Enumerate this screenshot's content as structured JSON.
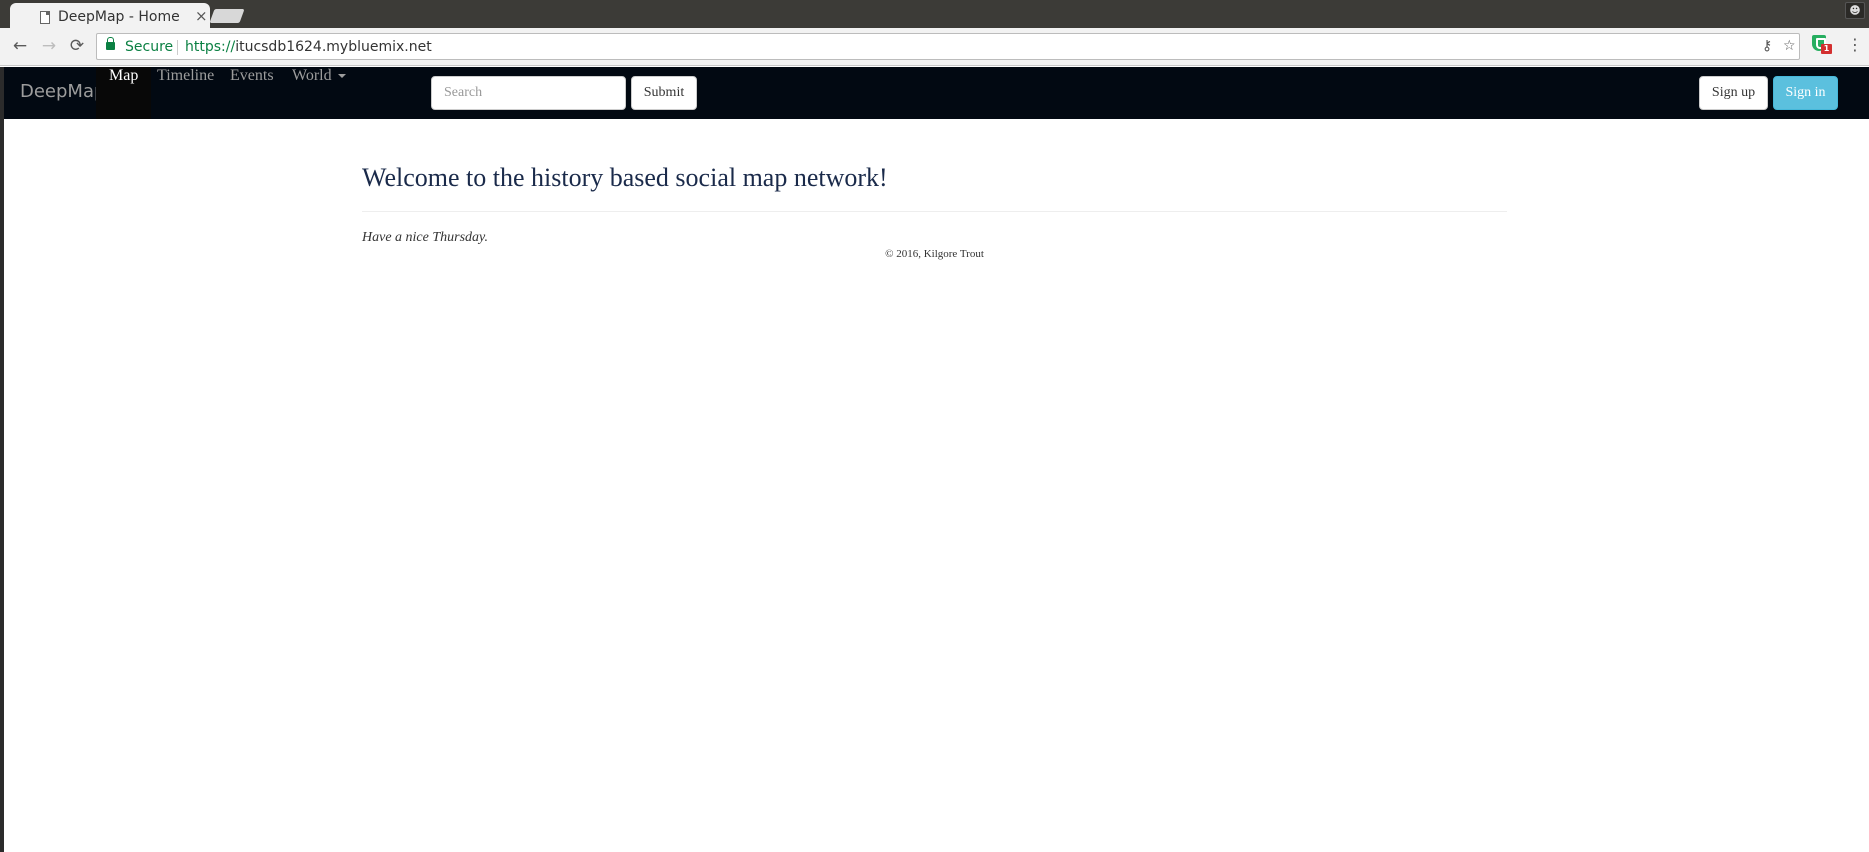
{
  "browser": {
    "tab_title": "DeepMap - Home",
    "tab_close": "×",
    "profile_icon": "person-icon",
    "back": "←",
    "forward": "→",
    "reload": "⟳",
    "secure_label": "Secure",
    "url_scheme": "https://",
    "url_host": "itucsdb1624.mybluemix.net",
    "extension_badge": "1",
    "menu": "⋮"
  },
  "navbar": {
    "brand": "DeepMap",
    "links": [
      {
        "label": "Map",
        "active": true
      },
      {
        "label": "Timeline",
        "active": false
      },
      {
        "label": "Events",
        "active": false
      },
      {
        "label": "World",
        "active": false,
        "dropdown": true
      }
    ],
    "search": {
      "placeholder": "Search",
      "value": ""
    },
    "submit_label": "Submit",
    "signup_label": "Sign up",
    "signin_label": "Sign in",
    "colors": {
      "navbar_bg": "#020912",
      "signin_bg": "#5bc0de"
    }
  },
  "main": {
    "heading": "Welcome to the history based social map network!",
    "greeting": "Have a nice Thursday.",
    "footer": "© 2016, Kilgore Trout"
  }
}
